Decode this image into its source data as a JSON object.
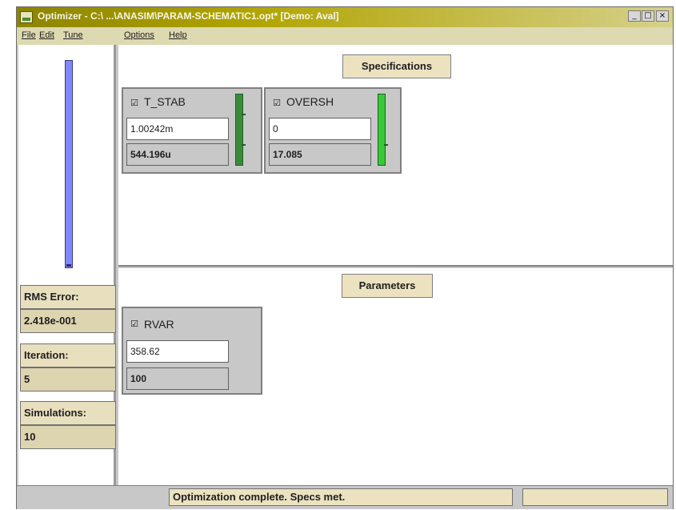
{
  "window": {
    "title": "Optimizer - C:\\ ...\\ANASIM\\PARAM-SCHEMATIC1.opt* [Demo: Aval]",
    "controls": {
      "minimize": "_",
      "maximize": "□",
      "close": "×"
    }
  },
  "menu": {
    "items": [
      "File",
      "Edit",
      "Tune",
      "Options",
      "Help"
    ]
  },
  "left_panel": {
    "error_bar_level": 1.0,
    "rms_error_label": "RMS Error:",
    "rms_error_value": "2.418e-001",
    "iteration_label": "Iteration:",
    "iteration_value": "5",
    "simulations_label": "Simulations:",
    "simulations_value": "10"
  },
  "specifications": {
    "title": "Specifications",
    "items": [
      {
        "checkbox": "☑",
        "checked": true,
        "name": "T_STAB",
        "target": "1.00242m",
        "current": "544.196u",
        "bar_level": 1.0
      },
      {
        "checkbox": "☑",
        "checked": true,
        "name": "OVERSH",
        "target": "0",
        "current": "17.085",
        "bar_level": 1.0
      }
    ]
  },
  "parameters": {
    "title": "Parameters",
    "items": [
      {
        "checkbox": "☑",
        "checked": true,
        "name": "RVAR",
        "current": "358.62",
        "initial": "100"
      }
    ]
  },
  "status": {
    "message": "Optimization complete.  Specs met.",
    "secondary": ""
  },
  "colors": {
    "title_bar": "#8c8400",
    "menu_bar": "#ddd9b0",
    "error_bar": "#8088ff",
    "spec_bar": "#38c838",
    "label_bg": "#ece2c0"
  }
}
